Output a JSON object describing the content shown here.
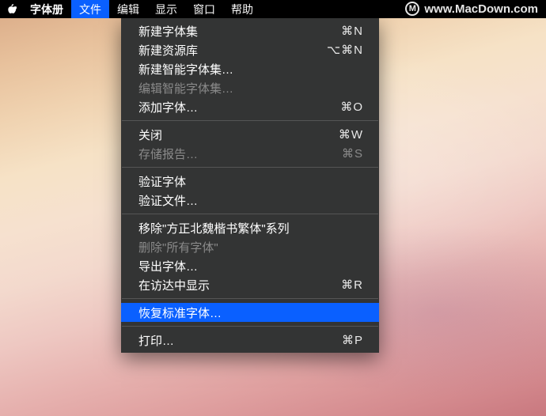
{
  "menubar": {
    "app_name": "字体册",
    "items": [
      {
        "label": "文件",
        "active": true
      },
      {
        "label": "编辑",
        "active": false
      },
      {
        "label": "显示",
        "active": false
      },
      {
        "label": "窗口",
        "active": false
      },
      {
        "label": "帮助",
        "active": false
      }
    ]
  },
  "watermark": {
    "icon_letter": "M",
    "text": "www.MacDown.com"
  },
  "dropdown": {
    "groups": [
      [
        {
          "label": "新建字体集",
          "shortcut": "⌘N",
          "disabled": false,
          "highlight": false
        },
        {
          "label": "新建资源库",
          "shortcut": "⌥⌘N",
          "disabled": false,
          "highlight": false
        },
        {
          "label": "新建智能字体集…",
          "shortcut": "",
          "disabled": false,
          "highlight": false
        },
        {
          "label": "编辑智能字体集…",
          "shortcut": "",
          "disabled": true,
          "highlight": false
        },
        {
          "label": "添加字体…",
          "shortcut": "⌘O",
          "disabled": false,
          "highlight": false
        }
      ],
      [
        {
          "label": "关闭",
          "shortcut": "⌘W",
          "disabled": false,
          "highlight": false
        },
        {
          "label": "存储报告…",
          "shortcut": "⌘S",
          "disabled": true,
          "highlight": false
        }
      ],
      [
        {
          "label": "验证字体",
          "shortcut": "",
          "disabled": false,
          "highlight": false
        },
        {
          "label": "验证文件…",
          "shortcut": "",
          "disabled": false,
          "highlight": false
        }
      ],
      [
        {
          "label": "移除\"方正北魏楷书繁体\"系列",
          "shortcut": "",
          "disabled": false,
          "highlight": false
        },
        {
          "label": "删除\"所有字体\"",
          "shortcut": "",
          "disabled": true,
          "highlight": false
        },
        {
          "label": "导出字体…",
          "shortcut": "",
          "disabled": false,
          "highlight": false
        },
        {
          "label": "在访达中显示",
          "shortcut": "⌘R",
          "disabled": false,
          "highlight": false
        }
      ],
      [
        {
          "label": "恢复标准字体…",
          "shortcut": "",
          "disabled": false,
          "highlight": true
        }
      ],
      [
        {
          "label": "打印…",
          "shortcut": "⌘P",
          "disabled": false,
          "highlight": false
        }
      ]
    ]
  }
}
